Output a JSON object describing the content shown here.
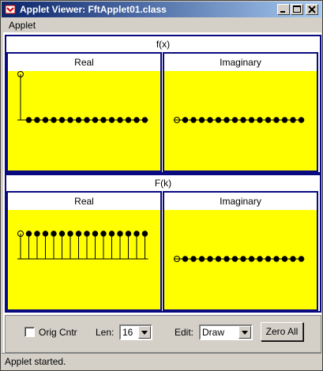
{
  "window": {
    "title": "Applet Viewer: FftApplet01.class",
    "menu": [
      "Applet"
    ],
    "status": "Applet started."
  },
  "top_section": {
    "title": "f(x)",
    "real_label": "Real",
    "imag_label": "Imaginary"
  },
  "bottom_section": {
    "title": "F(k)",
    "real_label": "Real",
    "imag_label": "Imaginary"
  },
  "controls": {
    "orig_cntr_label": "Orig Cntr",
    "orig_cntr_checked": false,
    "len_label": "Len:",
    "len_value": "16",
    "edit_label": "Edit:",
    "edit_value": "Draw",
    "zero_all_label": "Zero All"
  },
  "colors": {
    "plot_bg": "#ffff00",
    "border": "#0a0a80",
    "title_gradient_start": "#0a246a"
  },
  "plots": {
    "fx_real": [
      1,
      0,
      0,
      0,
      0,
      0,
      0,
      0,
      0,
      0,
      0,
      0,
      0,
      0,
      0,
      0
    ],
    "fx_imag": [
      0,
      0,
      0,
      0,
      0,
      0,
      0,
      0,
      0,
      0,
      0,
      0,
      0,
      0,
      0,
      0
    ],
    "fk_real": [
      1,
      1,
      1,
      1,
      1,
      1,
      1,
      1,
      1,
      1,
      1,
      1,
      1,
      1,
      1,
      1
    ],
    "fk_imag": [
      0,
      0,
      0,
      0,
      0,
      0,
      0,
      0,
      0,
      0,
      0,
      0,
      0,
      0,
      0,
      0
    ]
  }
}
